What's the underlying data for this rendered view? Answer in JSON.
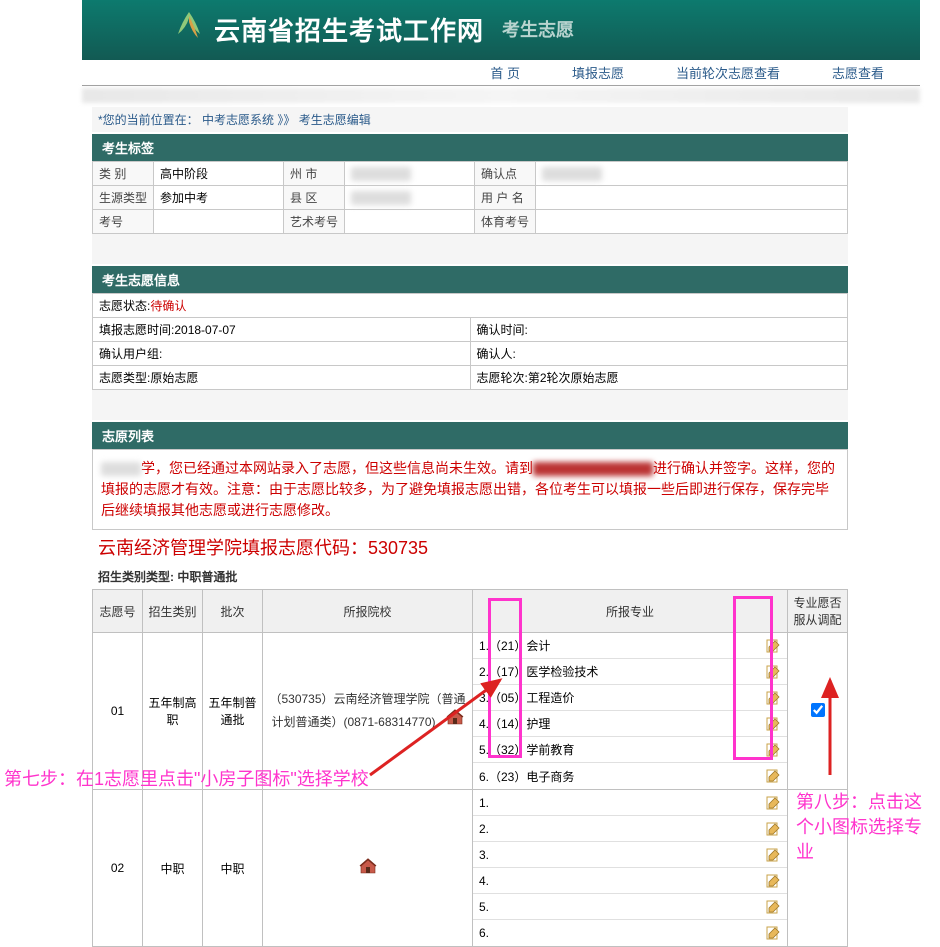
{
  "header": {
    "site_title": "云南省招生考试工作网",
    "sub_title": "考生志愿"
  },
  "nav": {
    "home": "首 页",
    "fill": "填报志愿",
    "view_round": "当前轮次志愿查看",
    "view": "志愿查看"
  },
  "breadcrumb": {
    "prefix": "*您的当前位置在：",
    "seg1": "中考志愿系统",
    "sep": " 》》 ",
    "seg2": "考生志愿编辑"
  },
  "section1_title": "考生标签",
  "labels1": {
    "category": "类  别",
    "category_val": "高中阶段",
    "city": "州   市",
    "confirm_point": "确认点",
    "source_type": "生源类型",
    "source_type_val": "参加中考",
    "county": "县   区",
    "username": "用 户 名",
    "exam_no": "考号",
    "art_no": "艺术考号",
    "sport_no": "体育考号"
  },
  "section2_title": "考生志愿信息",
  "info2": {
    "status_label": "志愿状态:",
    "status_val": "待确认",
    "fill_time_label": "填报志愿时间:",
    "fill_time_val": "2018-07-07",
    "confirm_time_label": "确认时间:",
    "confirm_group_label": "确认用户组:",
    "confirm_person_label": "确认人:",
    "type_label": "志愿类型:",
    "type_val": "原始志愿",
    "round_label": "志愿轮次:",
    "round_val": "第2轮次原始志愿"
  },
  "section3_title": "志原列表",
  "notice_text1": "学，您已经通过本网站录入了志愿，但这些信息尚未生效。请到",
  "notice_text2": "进行确认并签字。这样，您的填报的志愿才有效。注意：由于志愿比较多，为了避免填报志愿出错，各位考生可以填报一些后即进行保存，保存完毕后继续填报其他志愿或进行志愿修改。",
  "code_line": "云南经济管理学院填报志愿代码：530735",
  "enroll_type_label": "招生类别类型:",
  "enroll_type_val": "中职普通批",
  "vol_headers": {
    "no": "志愿号",
    "cat": "招生类别",
    "batch": "批次",
    "school": "所报院校",
    "major": "所报专业",
    "adjust": "专业愿否服从调配"
  },
  "row1": {
    "no": "01",
    "cat": "五年制高职",
    "batch": "五年制普通批",
    "school": "（530735）云南经济管理学院（普通计划普通类）(0871-68314770)",
    "majors": [
      "1.（21）会计",
      "2.（17）医学检验技术",
      "3.（05）工程造价",
      "4.（14）护理",
      "5.（32）学前教育",
      "6.（23）电子商务"
    ],
    "adjust_checked": true
  },
  "row2": {
    "no": "02",
    "cat": "中职",
    "batch": "中职",
    "majors": [
      "1.",
      "2.",
      "3.",
      "4.",
      "5.",
      "6."
    ]
  },
  "annotations": {
    "step7": "第七步：在1志愿里点击\"小房子图标\"选择学校",
    "step8": "第八步：点击这个小图标选择专业"
  }
}
